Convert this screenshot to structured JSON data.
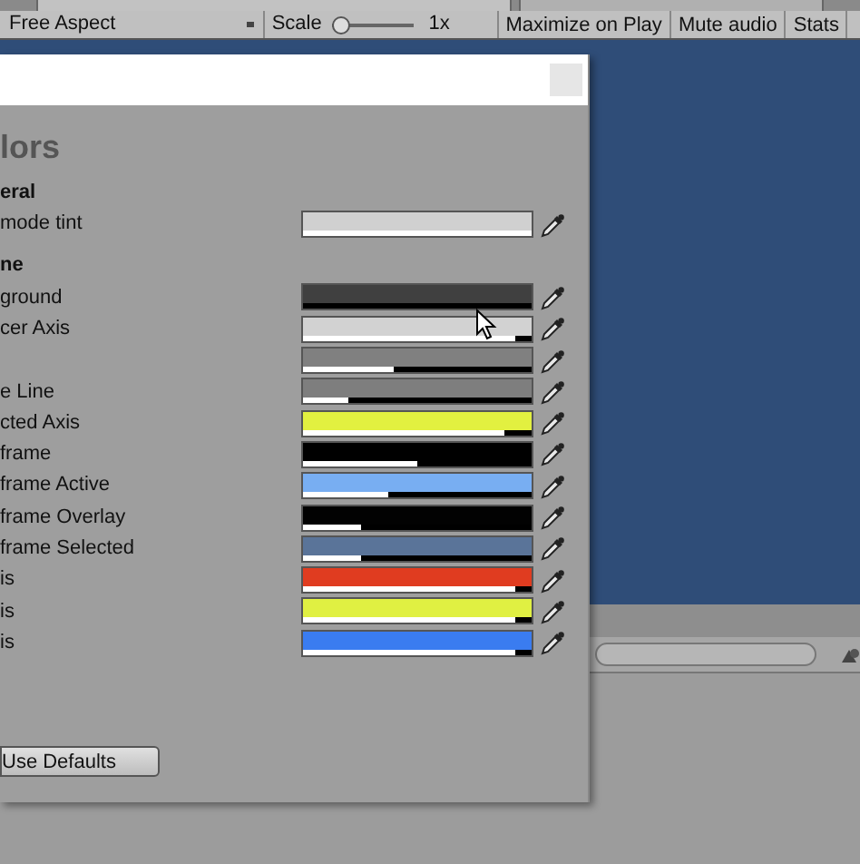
{
  "toolbar": {
    "aspect": "Free Aspect",
    "scale_label": "Scale",
    "scale": {
      "level": 0.0
    },
    "scale_value": "1x",
    "buttons": [
      "Maximize on Play",
      "Mute audio",
      "Stats"
    ]
  },
  "window": {
    "heading": "lors",
    "sections": [
      {
        "title": "eral",
        "rows": [
          {
            "label": "mode tint",
            "color": "#d0d0d0",
            "level": 1.0
          }
        ]
      },
      {
        "title": "ne",
        "rows": [
          {
            "label": "ground",
            "color": "#404040",
            "level": 0.0
          },
          {
            "label": "cer Axis",
            "color": "#d2d2d2",
            "level": 0.93
          },
          {
            "label": "",
            "color": "#808080",
            "level": 0.4
          },
          {
            "label": "e Line",
            "color": "#7e7e7e",
            "level": 0.2
          },
          {
            "label": "cted Axis",
            "color": "#e2f040",
            "level": 0.88
          },
          {
            "label": "frame",
            "color": "#000000",
            "level": 0.5
          },
          {
            "label": "frame Active",
            "color": "#78aef2",
            "level": 0.37
          },
          {
            "label": "frame Overlay",
            "color": "#020202",
            "level": 0.25
          },
          {
            "label": "frame Selected",
            "color": "#5a7499",
            "level": 0.25
          },
          {
            "label": "is",
            "color": "#e03c20",
            "level": 0.93
          },
          {
            "label": "is",
            "color": "#e0f042",
            "level": 0.93
          },
          {
            "label": "is",
            "color": "#3a7cf0",
            "level": 0.93
          }
        ]
      }
    ],
    "defaults_button": "Use Defaults"
  }
}
